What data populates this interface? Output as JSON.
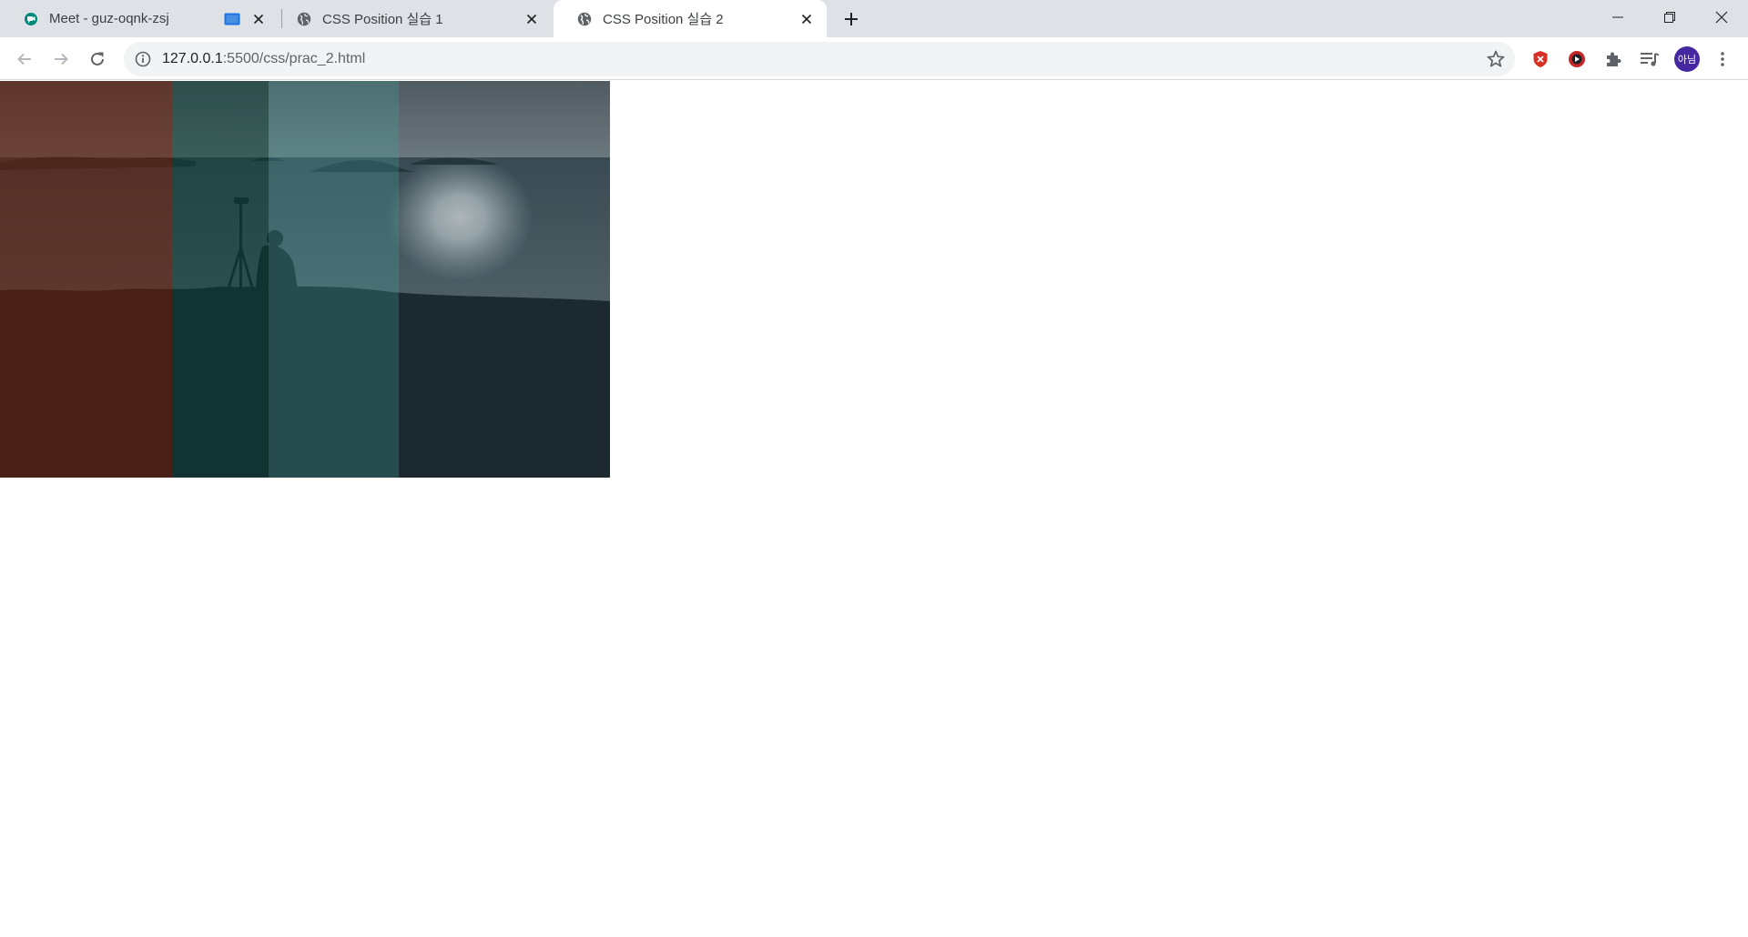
{
  "browser": {
    "tabs": [
      {
        "title": "Meet - guz-oqnk-zsj",
        "active": false,
        "icon": "google-meet-icon"
      },
      {
        "title": "CSS Position 실습 1",
        "active": false,
        "icon": "globe-icon"
      },
      {
        "title": "CSS Position 실습 2",
        "active": true,
        "icon": "globe-icon"
      }
    ],
    "new_tab_icon": "plus-icon",
    "window_controls": [
      "minimize-icon",
      "restore-icon",
      "close-icon"
    ]
  },
  "toolbar": {
    "url_host": "127.0.0.1",
    "url_rest": ":5500/css/prac_2.html",
    "avatar_label": "아님"
  },
  "page": {
    "image_description_icon": "sea-landscape-photo",
    "overlay_colors": [
      "#5a1e10",
      "#0b3a34",
      "#2f6b6e",
      "#1b2e36"
    ]
  },
  "colors": {
    "tabstrip": "#dee1e6",
    "active_tab": "#ffffff",
    "avatar": "#4527a0"
  }
}
